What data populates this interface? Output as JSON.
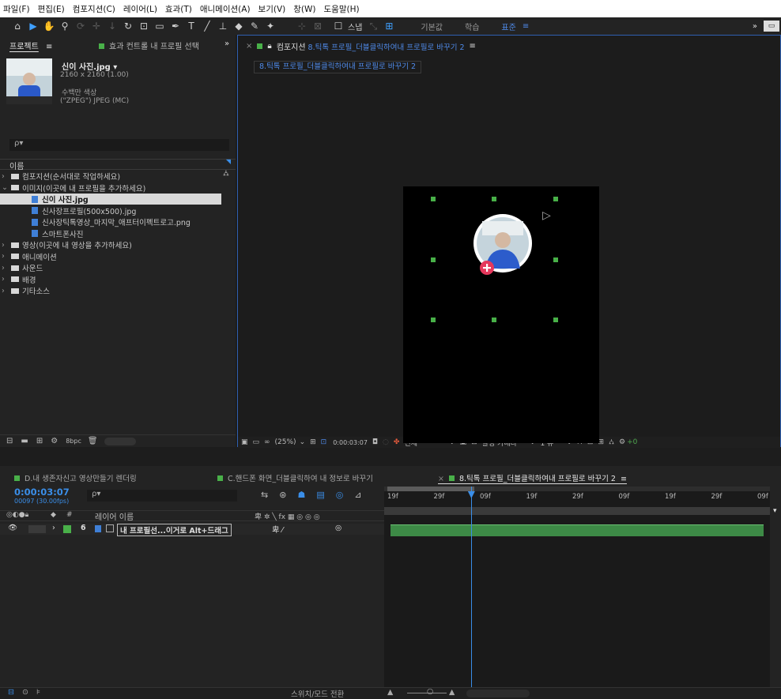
{
  "menu": [
    "파일(F)",
    "편집(E)",
    "컴포지션(C)",
    "레이어(L)",
    "효과(T)",
    "애니메이션(A)",
    "보기(V)",
    "창(W)",
    "도움말(H)"
  ],
  "toolbar": {
    "snap_label": "스냅",
    "workspaces": [
      "기본값",
      "학습",
      "표준"
    ],
    "more": "»"
  },
  "project": {
    "tab": "프로젝트",
    "tab_menu": "≡",
    "effects_tab": "효과 컨트롤 내 프로필 선택",
    "more": "»",
    "item_name": "신이 사진.jpg ▾",
    "item_size": "2160 x 2160 (1.00)",
    "item_color": "수백만 색상",
    "item_format": "(\"ZPEG\") JPEG (MC)",
    "search_placeholder": "ρ▾",
    "col_name": "이름",
    "tree": [
      {
        "label": "컴포지션(순서대로 작업하세요)",
        "type": "folder",
        "indent": 0,
        "arrow": "›"
      },
      {
        "label": "이미지(이곳에 내 프로필을 추가하세요)",
        "type": "folder",
        "indent": 0,
        "arrow": "⌄"
      },
      {
        "label": "신이 사진.jpg",
        "type": "file",
        "indent": 1,
        "selected": true
      },
      {
        "label": "신사장프로필(500x500).jpg",
        "type": "file",
        "indent": 1
      },
      {
        "label": "신사장틱톡영상_마지막_애프터이펙트로고.png",
        "type": "file",
        "indent": 1
      },
      {
        "label": "스마트폰사진",
        "type": "file",
        "indent": 1
      },
      {
        "label": "영상(이곳에 내 영상을 추가하세요)",
        "type": "folder",
        "indent": 0,
        "arrow": "›"
      },
      {
        "label": "애니메이션",
        "type": "folder",
        "indent": 0,
        "arrow": "›"
      },
      {
        "label": "사운드",
        "type": "folder",
        "indent": 0,
        "arrow": "›"
      },
      {
        "label": "배경",
        "type": "folder",
        "indent": 0,
        "arrow": "›"
      },
      {
        "label": "기타소스",
        "type": "folder",
        "indent": 0,
        "arrow": "›"
      }
    ],
    "bpc": "8bpc"
  },
  "comp": {
    "tab_close": "×",
    "tab_prefix": "컴포지션",
    "tab_name": "8.틱톡 프로필_더블클릭하여내 프로필로 바꾸기 2",
    "tab_menu": "≡",
    "breadcrumb": "8.틱톡 프로필_더블클릭하여내 프로필로 바꾸기 2",
    "zoom": "(25%)",
    "timecode": "0:00:03:07",
    "resolution": "전체",
    "camera": "활성 카메라",
    "views": "1 뷰"
  },
  "timeline": {
    "tabs": [
      {
        "label": "D.내 생존자신고 영상만들기 렌더링",
        "active": false
      },
      {
        "label": "C.핸드폰 화면_더블클릭하여 내 정보로 바꾸기",
        "active": false
      },
      {
        "label": "8.틱톡 프로필_더블클릭하여내 프로필로 바꾸기 2",
        "active": true
      }
    ],
    "tab_close": "×",
    "tab_menu": "≡",
    "timecode": "0:00:03:07",
    "frames": "00097 (30.00fps)",
    "search_placeholder": "ρ▾",
    "col_hash": "#",
    "col_layer": "레이어 이름",
    "col_switches": "卑 ✲ ╲ fx ▦ ◎ ◎ ◎",
    "ruler": [
      "19f",
      "29f",
      "09f",
      "19f",
      "29f",
      "09f",
      "19f",
      "29f",
      "09f"
    ],
    "layer": {
      "num": "6",
      "name": "내 프로필선...이거로 Alt+드래그",
      "mode": "卑   ⁄"
    },
    "footer": "스위치/모드 전환",
    "playhead_fraction": 0.225
  }
}
